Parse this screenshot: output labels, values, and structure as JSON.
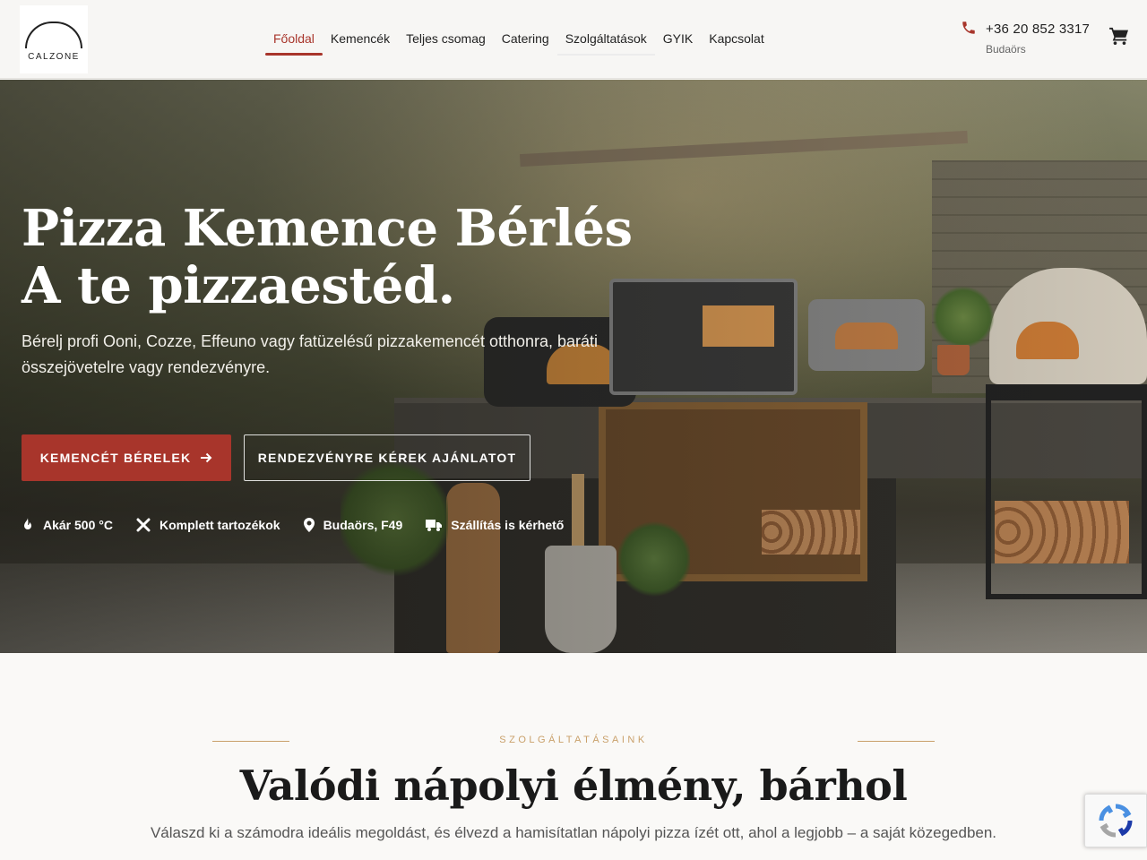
{
  "header": {
    "logo_text": "CALZONE",
    "nav": [
      {
        "label": "Főoldal",
        "active": true
      },
      {
        "label": "Kemencék"
      },
      {
        "label": "Teljes csomag"
      },
      {
        "label": "Catering"
      },
      {
        "label": "Szolgáltatások"
      },
      {
        "label": "GYIK"
      },
      {
        "label": "Kapcsolat"
      }
    ],
    "phone": "+36 20 852 3317",
    "location": "Budaörs",
    "phone_icon": "phone-icon",
    "cart_icon": "cart-icon"
  },
  "hero": {
    "title_line1": "Pizza Kemence Bérlés",
    "title_line2": "A te pizzaestéd.",
    "subtitle": "Bérelj profi Ooni, Cozze, Effeuno vagy fatüzelésű pizzakemencét otthonra, baráti összejövetelre vagy rendezvényre.",
    "primary_button": "KEMENCÉT BÉRELEK",
    "secondary_button": "RENDEZVÉNYRE KÉREK AJÁNLATOT",
    "features": [
      {
        "icon": "flame-icon",
        "label": "Akár 500 °C"
      },
      {
        "icon": "tools-icon",
        "label": "Komplett tartozékok"
      },
      {
        "icon": "map-pin-icon",
        "label": "Budaörs, F49"
      },
      {
        "icon": "truck-icon",
        "label": "Szállítás is kérhető"
      }
    ]
  },
  "services": {
    "eyebrow": "SZOLGÁLTATÁSAINK",
    "title": "Valódi nápolyi élmény, bárhol",
    "description": "Válaszd ki a számodra ideális megoldást, és élvezd a hamisítatlan nápolyi pizza ízét ott, ahol a legjobb – a saját közegedben."
  },
  "colors": {
    "accent": "#a8352b",
    "gold": "#c9a06a",
    "background": "#faf9f7"
  }
}
